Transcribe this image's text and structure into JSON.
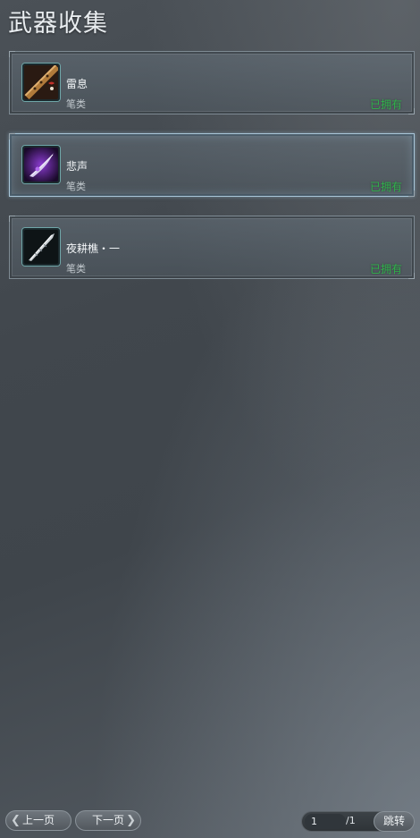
{
  "header": {
    "title": "武器收集"
  },
  "weapons": [
    {
      "name": "雷息",
      "type": "笔类",
      "status": "已拥有",
      "icon": "brush-flute-icon",
      "selected": false
    },
    {
      "name": "悲声",
      "type": "笔类",
      "status": "已拥有",
      "icon": "purple-feather-icon",
      "selected": true
    },
    {
      "name": "夜耕樵・一",
      "type": "笔类",
      "status": "已拥有",
      "icon": "silver-blade-icon",
      "selected": false
    }
  ],
  "pagination": {
    "prev_label": "上一页",
    "next_label": "下一页",
    "current_page": "1",
    "total_label": "/1",
    "jump_label": "跳转"
  },
  "colors": {
    "owned": "#2fb34a",
    "selected_border": "#a9c6d8"
  }
}
